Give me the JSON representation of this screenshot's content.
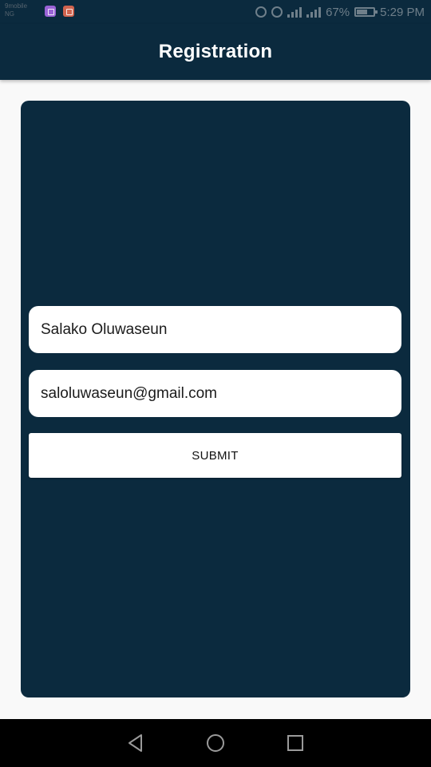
{
  "status_bar": {
    "carrier": "9mobile NG",
    "battery": "67%",
    "time": "5:29 PM",
    "colors": {
      "background": "#0b2a3e",
      "icon": "#6f7f8a"
    }
  },
  "app_bar": {
    "title": "Registration"
  },
  "form": {
    "name_value": "Salako  Oluwaseun",
    "email_value": "saloluwaseun@gmail.com",
    "submit_label": "SUBMIT"
  },
  "nav_bar": {
    "icons": [
      "back-icon",
      "home-icon",
      "recents-icon"
    ]
  },
  "colors": {
    "primary": "#0b2a3e",
    "page_background": "#f9f9f9",
    "field_background": "#ffffff"
  }
}
